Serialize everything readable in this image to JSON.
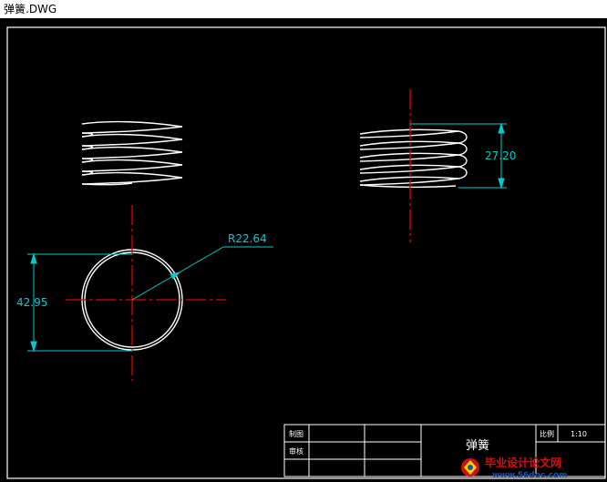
{
  "window": {
    "title": "弹簧.DWG"
  },
  "drawing": {
    "dimensions": {
      "side_height": "27.20",
      "radius": "R22.64",
      "diameter": "42.95"
    },
    "title_block": {
      "drawn_label": "制图",
      "review_label": "审核",
      "part_name": "弹簧",
      "scale_label": "比例",
      "scale_value": "1:10"
    }
  },
  "colors": {
    "background": "#000000",
    "geometry": "#ffffff",
    "dimension": "#00cccc",
    "centerline": "#e00000",
    "watermark_red": "#cc1111",
    "watermark_blue": "#1a4fb8"
  },
  "watermark": {
    "title": "毕业设计论文网",
    "url": "www.56doc.com"
  }
}
